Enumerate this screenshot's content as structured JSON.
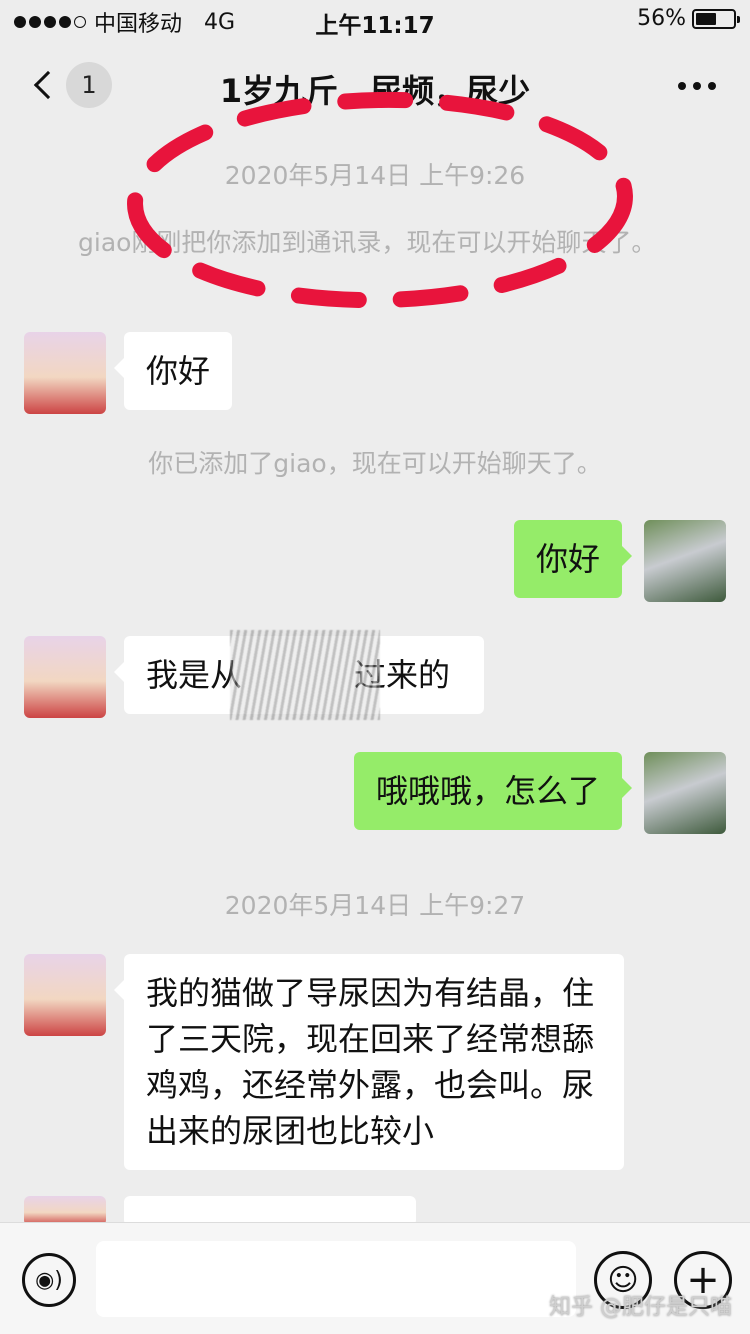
{
  "status_bar": {
    "carrier": "中国移动",
    "network": "4G",
    "time": "上午11:17",
    "battery_percent": "56%",
    "battery_level": 0.56
  },
  "nav": {
    "unread_count": "1",
    "title": "1岁九斤，尿频，尿少"
  },
  "chat": {
    "timestamp_1": "2020年5月14日 上午9:26",
    "system_1": "giao刚刚把你添加到通讯录，现在可以开始聊天了。",
    "msg_1": "你好",
    "system_2": "你已添加了giao，现在可以开始聊天了。",
    "msg_2": "你好",
    "msg_3": "我是从",
    "msg_3_end": "过来的",
    "msg_4": "哦哦哦，怎么了",
    "timestamp_2": "2020年5月14日 上午9:27",
    "msg_5": "我的猫做了导尿因为有结晶，住了三天院，现在回来了经常想舔鸡鸡，还经常外露，也会叫。尿出来的尿团也比较小"
  },
  "input_bar": {
    "voice_icon": "voice-icon",
    "emoji_icon": "emoji-icon",
    "plus_icon": "plus-icon"
  },
  "watermark": "知乎 @肥仔是只喵",
  "colors": {
    "background": "#ededed",
    "outgoing_bubble": "#95ec69",
    "incoming_bubble": "#ffffff",
    "annotation_red": "#e8143c"
  }
}
